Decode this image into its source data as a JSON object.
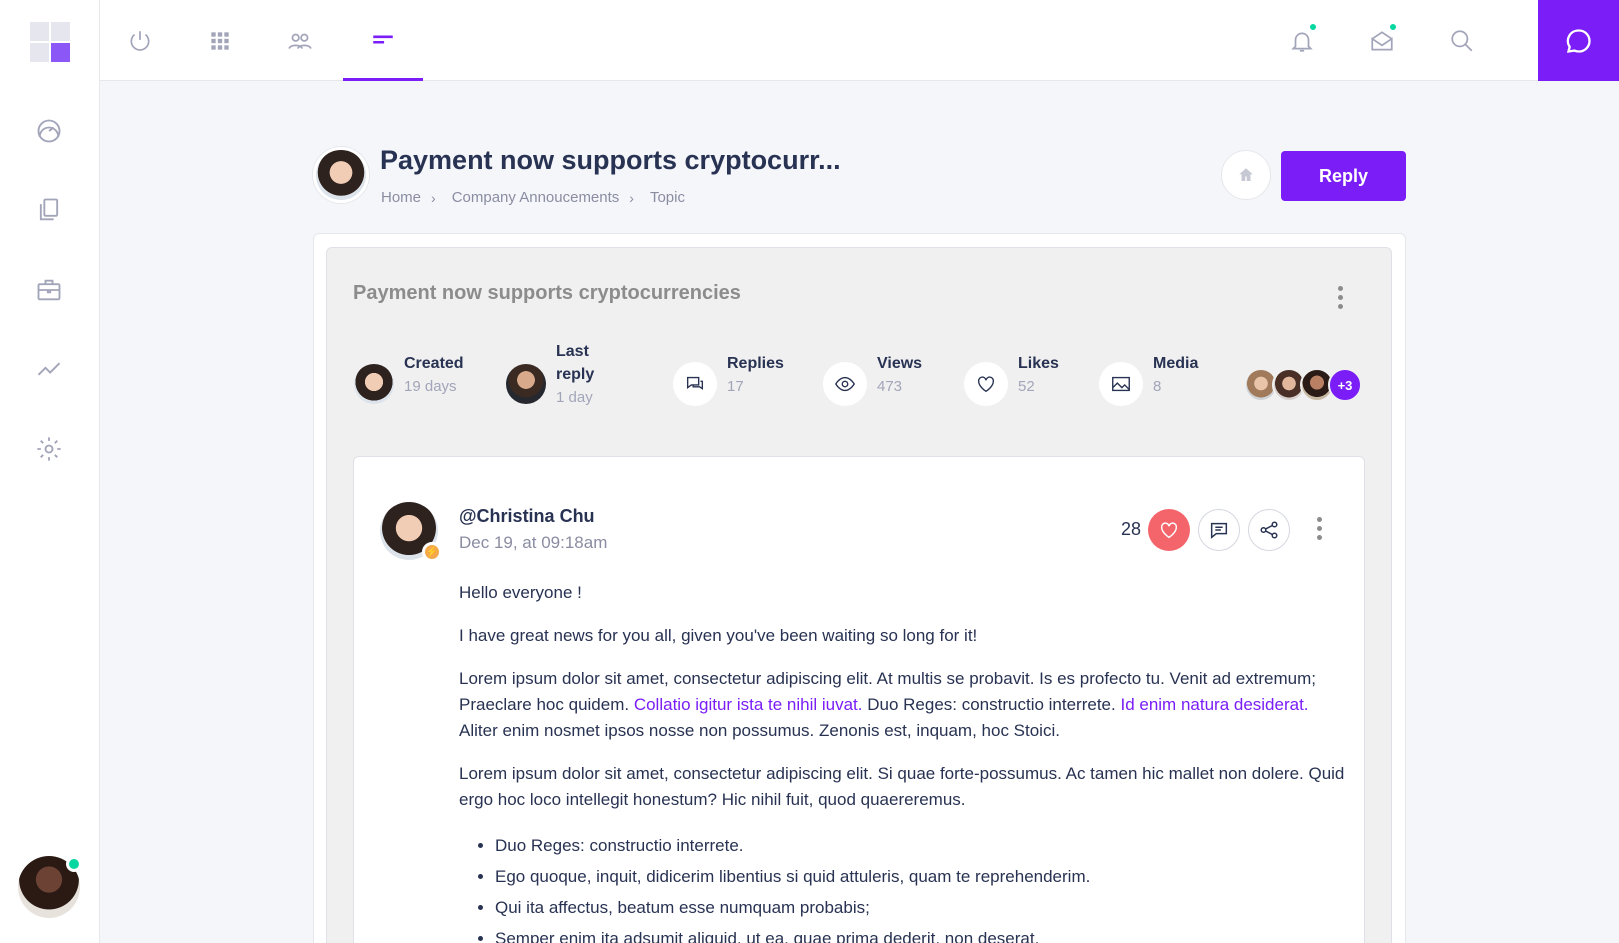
{
  "colors": {
    "accent": "#7a1df7",
    "online": "#06d6a0",
    "like": "#f4646b"
  },
  "sidebar": {
    "items": [
      {
        "icon": "dashboard-gauge-icon"
      },
      {
        "icon": "documents-icon"
      },
      {
        "icon": "briefcase-icon"
      },
      {
        "icon": "analytics-chart-icon"
      },
      {
        "icon": "settings-gear-icon"
      }
    ]
  },
  "topbar": {
    "nav": [
      {
        "icon": "power-icon"
      },
      {
        "icon": "apps-grid-icon"
      },
      {
        "icon": "users-icon"
      },
      {
        "icon": "menu-lines-icon",
        "active": true
      }
    ],
    "right": [
      {
        "icon": "bell-icon",
        "badge": true
      },
      {
        "icon": "inbox-icon",
        "badge": true
      },
      {
        "icon": "search-icon"
      }
    ]
  },
  "header": {
    "title": "Payment now supports cryptocurr...",
    "breadcrumb": [
      "Home",
      "Company Annoucements",
      "Topic"
    ],
    "reply_label": "Reply"
  },
  "topic": {
    "title": "Payment now supports cryptocurrencies",
    "stats": {
      "created": {
        "label": "Created",
        "value": "19 days"
      },
      "last_reply": {
        "label_line1": "Last",
        "label_line2": "reply",
        "value": "1 day"
      },
      "replies": {
        "label": "Replies",
        "value": "17"
      },
      "views": {
        "label": "Views",
        "value": "473"
      },
      "likes": {
        "label": "Likes",
        "value": "52"
      },
      "media": {
        "label": "Media",
        "value": "8"
      }
    },
    "participants_more": "+3"
  },
  "post": {
    "user": "@Christina Chu",
    "date": "Dec 19, at 09:18am",
    "likes": "28",
    "greeting": "Hello everyone !",
    "intro": "I have great news for you all, given you've been waiting so long for it!",
    "p1_a": "Lorem ipsum dolor sit amet, consectetur adipiscing elit. At multis se probavit. Is es profecto tu. Venit ad extremum; Praeclare hoc quidem. ",
    "p1_link1": "Collatio igitur ista te nihil iuvat.",
    "p1_b": " Duo Reges: constructio interrete. ",
    "p1_link2": "Id enim natura desiderat.",
    "p1_c": " Aliter enim nosmet ipsos nosse non possumus. Zenonis est, inquam, hoc Stoici.",
    "p2": "Lorem ipsum dolor sit amet, consectetur adipiscing elit. Si quae forte-possumus. Ac tamen hic mallet non dolere. Quid ergo hoc loco intellegit honestum? Hic nihil fuit, quod quaereremus.",
    "list": [
      "Duo Reges: constructio interrete.",
      "Ego quoque, inquit, didicerim libentius si quid attuleris, quam te reprehenderim.",
      "Qui ita affectus, beatum esse numquam probabis;",
      "Semper enim ita adsumit aliquid, ut ea, quae prima dederit, non deserat."
    ]
  }
}
